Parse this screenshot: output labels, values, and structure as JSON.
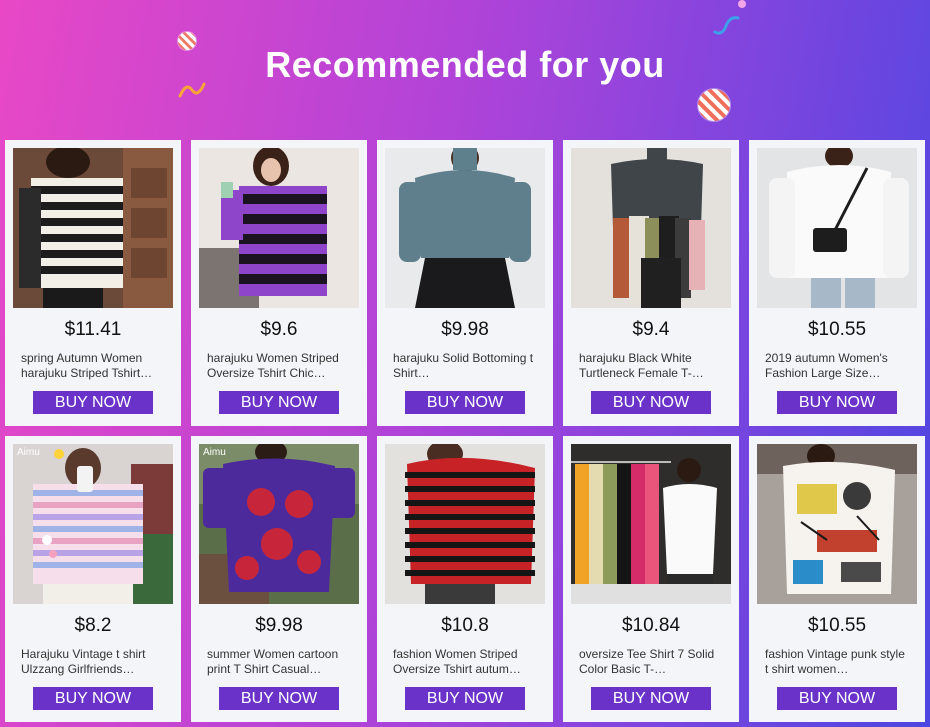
{
  "header": {
    "title": "Recommended for you"
  },
  "theme": {
    "button_color": "#6a32c8",
    "card_bg": "#f4f5f8"
  },
  "products": [
    {
      "price": "$11.41",
      "name": "spring Autumn Women harajuku Striped Tshirt…",
      "button": "BUY NOW",
      "image": "black-white-striped-tshirt"
    },
    {
      "price": "$9.6",
      "name": "harajuku Women Striped Oversize Tshirt Chic…",
      "button": "BUY NOW",
      "image": "purple-black-striped-tshirt"
    },
    {
      "price": "$9.98",
      "name": "harajuku Solid Bottoming t Shirt…",
      "button": "BUY NOW",
      "image": "gray-turtleneck"
    },
    {
      "price": "$9.4",
      "name": "harajuku Black White Turtleneck Female T-…",
      "button": "BUY NOW",
      "image": "colored-turtlenecks"
    },
    {
      "price": "$10.55",
      "name": "2019 autumn Women's Fashion Large Size…",
      "button": "BUY NOW",
      "image": "white-oversize-tshirt"
    },
    {
      "price": "$8.2",
      "name": "Harajuku Vintage t shirt Ulzzang Girlfriends…",
      "button": "BUY NOW",
      "image": "pastel-striped-tshirt",
      "brand": "Aimu"
    },
    {
      "price": "$9.98",
      "name": "summer Women cartoon print T Shirt Casual…",
      "button": "BUY NOW",
      "image": "purple-print-tshirt",
      "brand": "Aimu"
    },
    {
      "price": "$10.8",
      "name": "fashion Women Striped Oversize Tshirt autum…",
      "button": "BUY NOW",
      "image": "red-black-striped-tshirt"
    },
    {
      "price": "$10.84",
      "name": "oversize Tee Shirt 7 Solid Color Basic T-…",
      "button": "BUY NOW",
      "image": "solid-color-tees"
    },
    {
      "price": "$10.55",
      "name": "fashion Vintage punk style t shirt women…",
      "button": "BUY NOW",
      "image": "graffiti-print-tshirt"
    }
  ]
}
